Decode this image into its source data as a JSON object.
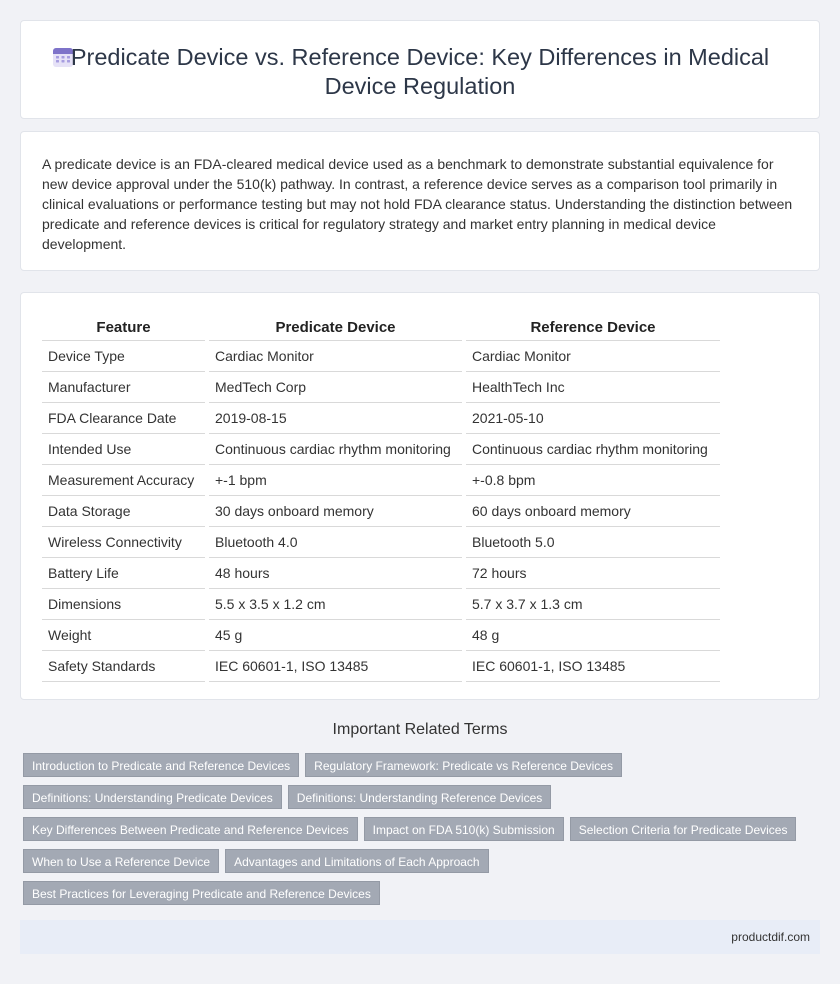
{
  "header": {
    "title": "Predicate Device vs. Reference Device: Key Differences in Medical Device Regulation",
    "icon": "calendar-icon"
  },
  "intro": {
    "text": "A predicate device is an FDA-cleared medical device used as a benchmark to demonstrate substantial equivalence for new device approval under the 510(k) pathway. In contrast, a reference device serves as a comparison tool primarily in clinical evaluations or performance testing but may not hold FDA clearance status. Understanding the distinction between predicate and reference devices is critical for regulatory strategy and market entry planning in medical device development."
  },
  "table": {
    "headers": [
      "Feature",
      "Predicate Device",
      "Reference Device"
    ],
    "rows": [
      [
        "Device Type",
        "Cardiac Monitor",
        "Cardiac Monitor"
      ],
      [
        "Manufacturer",
        "MedTech Corp",
        "HealthTech Inc"
      ],
      [
        "FDA Clearance Date",
        "2019-08-15",
        "2021-05-10"
      ],
      [
        "Intended Use",
        "Continuous cardiac rhythm monitoring",
        "Continuous cardiac rhythm monitoring"
      ],
      [
        "Measurement Accuracy",
        "+-1 bpm",
        "+-0.8 bpm"
      ],
      [
        "Data Storage",
        "30 days onboard memory",
        "60 days onboard memory"
      ],
      [
        "Wireless Connectivity",
        "Bluetooth 4.0",
        "Bluetooth 5.0"
      ],
      [
        "Battery Life",
        "48 hours",
        "72 hours"
      ],
      [
        "Dimensions",
        "5.5 x 3.5 x 1.2 cm",
        "5.7 x 3.7 x 1.3 cm"
      ],
      [
        "Weight",
        "45 g",
        "48 g"
      ],
      [
        "Safety Standards",
        "IEC 60601-1, ISO 13485",
        "IEC 60601-1, ISO 13485"
      ]
    ]
  },
  "related": {
    "title": "Important Related Terms",
    "tags": [
      "Introduction to Predicate and Reference Devices",
      "Regulatory Framework: Predicate vs Reference Devices",
      "Definitions: Understanding Predicate Devices",
      "Definitions: Understanding Reference Devices",
      "Key Differences Between Predicate and Reference Devices",
      "Impact on FDA 510(k) Submission",
      "Selection Criteria for Predicate Devices",
      "When to Use a Reference Device",
      "Advantages and Limitations of Each Approach",
      "Best Practices for Leveraging Predicate and Reference Devices"
    ]
  },
  "footer": {
    "site": "productdif.com"
  }
}
